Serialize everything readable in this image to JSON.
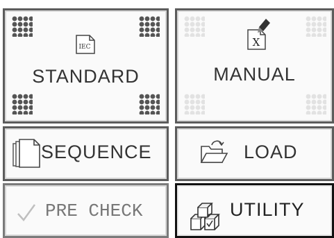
{
  "buttons": {
    "standard": {
      "label": "STANDARD",
      "icon": "iec-document-icon",
      "icon_text": "IEC"
    },
    "manual": {
      "label": "MANUAL",
      "icon": "manual-x-document-icon",
      "icon_text": "X"
    },
    "sequence": {
      "label": "SEQUENCE",
      "icon": "stacked-pages-icon"
    },
    "load": {
      "label": "LOAD",
      "icon": "open-folder-icon"
    },
    "pre_check": {
      "label": "PRE CHECK",
      "icon": "checkmark-icon",
      "state": "disabled"
    },
    "utility": {
      "label": "UTILITY",
      "icon": "cubes-icon",
      "state": "selected"
    }
  },
  "colors": {
    "border": "#5c5c5c",
    "selected_border": "#111111",
    "text": "#333333",
    "disabled_text": "#8a8a8a",
    "dots_active": "#555555",
    "dots_inactive": "#e2e2e2"
  }
}
